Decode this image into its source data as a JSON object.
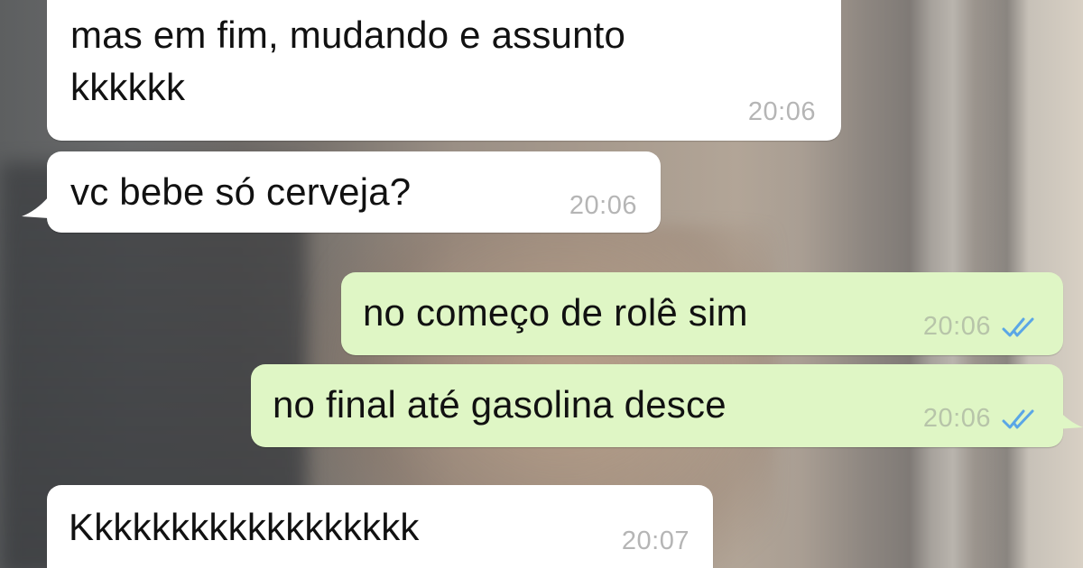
{
  "messages": [
    {
      "text": "mas em fim, mudando e assunto\nkkkkkk",
      "time": "20:06",
      "direction": "in"
    },
    {
      "text": "vc bebe só cerveja?",
      "time": "20:06",
      "direction": "in"
    },
    {
      "text": "no começo de rolê sim",
      "time": "20:06",
      "direction": "out",
      "status": "read-double-check-icon"
    },
    {
      "text": "no final até gasolina desce",
      "time": "20:06",
      "direction": "out",
      "status": "read-double-check-icon"
    },
    {
      "text": "Kkkkkkkkkkkkkkkkkk",
      "time": "20:07",
      "direction": "in"
    }
  ],
  "colors": {
    "incoming_bubble": "#ffffff",
    "outgoing_bubble": "#dff6c5",
    "read_ticks": "#5aa6e6",
    "timestamp": "#b5b5b5"
  }
}
